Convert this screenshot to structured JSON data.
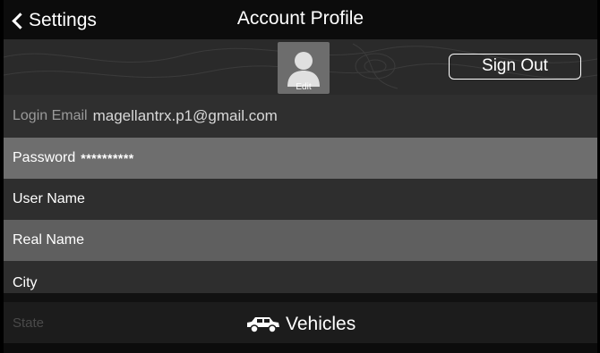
{
  "nav": {
    "back_label": "Settings",
    "title": "Account Profile"
  },
  "profile": {
    "avatar_edit_label": "Edit",
    "sign_out_label": "Sign Out"
  },
  "fields": {
    "login_email_label": "Login Email",
    "login_email_value": "magellantrx.p1@gmail.com",
    "password_label": "Password",
    "password_value": "**********",
    "user_name_label": "User Name",
    "real_name_label": "Real Name",
    "city_label": "City",
    "state_label": "State"
  },
  "footer": {
    "vehicles_label": "Vehicles",
    "vehicles_icon": "car-icon"
  },
  "colors": {
    "background": "#1e1e1e",
    "nav_bar": "#0c0c0c",
    "highlight_row": "#6e6e6e",
    "text": "#ffffff"
  }
}
